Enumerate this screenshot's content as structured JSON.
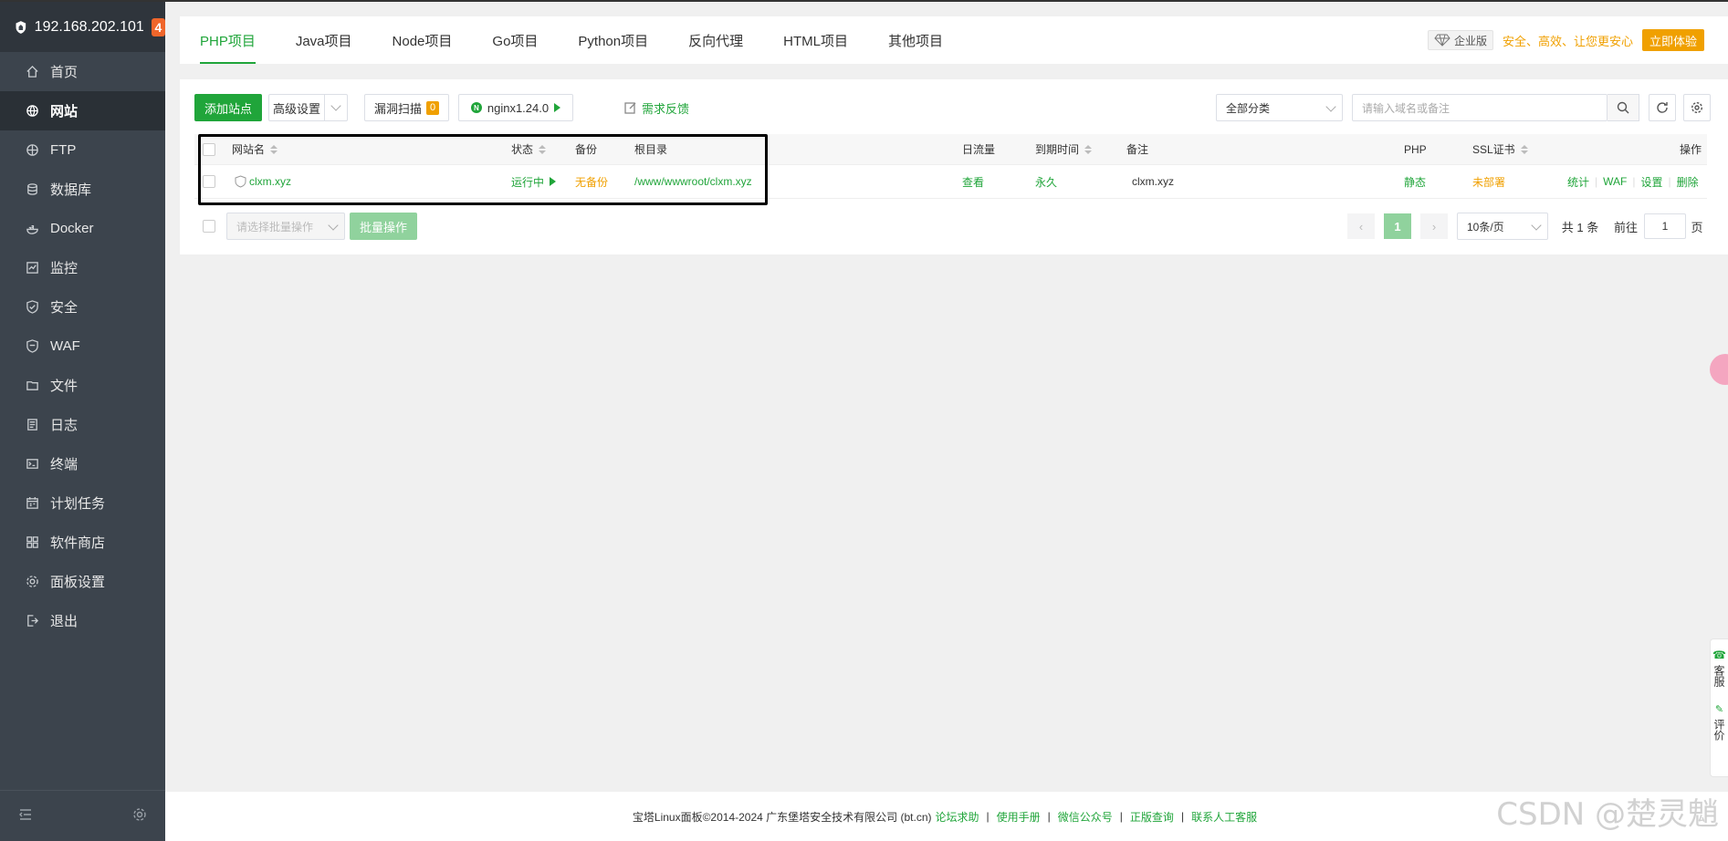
{
  "sidebar": {
    "ip": "192.168.202.101",
    "badge": "4",
    "items": [
      {
        "label": "首页",
        "icon": "home-icon"
      },
      {
        "label": "网站",
        "icon": "globe-icon",
        "active": true
      },
      {
        "label": "FTP",
        "icon": "ftp-globe-icon"
      },
      {
        "label": "数据库",
        "icon": "database-icon"
      },
      {
        "label": "Docker",
        "icon": "docker-icon"
      },
      {
        "label": "监控",
        "icon": "monitor-icon"
      },
      {
        "label": "安全",
        "icon": "shield-icon"
      },
      {
        "label": "WAF",
        "icon": "waf-shield-icon"
      },
      {
        "label": "文件",
        "icon": "folder-icon"
      },
      {
        "label": "日志",
        "icon": "log-icon"
      },
      {
        "label": "终端",
        "icon": "terminal-icon"
      },
      {
        "label": "计划任务",
        "icon": "calendar-icon"
      },
      {
        "label": "软件商店",
        "icon": "apps-icon"
      },
      {
        "label": "面板设置",
        "icon": "gear-icon"
      },
      {
        "label": "退出",
        "icon": "logout-icon"
      }
    ]
  },
  "tabs": [
    "PHP项目",
    "Java项目",
    "Node项目",
    "Go项目",
    "Python项目",
    "反向代理",
    "HTML项目",
    "其他项目"
  ],
  "promo": {
    "edition": "企业版",
    "slogan": "安全、高效、让您更安心",
    "try_label": "立即体验"
  },
  "toolbar": {
    "add_site": "添加站点",
    "advanced": "高级设置",
    "vuln_scan": "漏洞扫描",
    "vuln_count": "0",
    "nginx": "nginx1.24.0",
    "nginx_badge": "N",
    "feedback": "需求反馈",
    "category": "全部分类",
    "search_placeholder": "请输入域名或备注"
  },
  "table": {
    "headers": {
      "name": "网站名",
      "status": "状态",
      "backup": "备份",
      "root": "根目录",
      "traffic": "日流量",
      "expire": "到期时间",
      "remark": "备注",
      "php": "PHP",
      "ssl": "SSL证书",
      "ops": "操作"
    },
    "rows": [
      {
        "name": "clxm.xyz",
        "status": "运行中",
        "backup": "无备份",
        "root": "/www/wwwroot/clxm.xyz",
        "traffic": "查看",
        "expire": "永久",
        "remark": "clxm.xyz",
        "php": "静态",
        "ssl": "未部署",
        "ops": [
          "统计",
          "WAF",
          "设置",
          "删除"
        ]
      }
    ]
  },
  "bulk": {
    "select_placeholder": "请选择批量操作",
    "button": "批量操作"
  },
  "pagination": {
    "current": "1",
    "per_page": "10条/页",
    "total": "共 1 条",
    "goto_label": "前往",
    "goto_value": "1",
    "page_suffix": "页"
  },
  "footer": {
    "copyright": "宝塔Linux面板©2014-2024 广东堡塔安全技术有限公司 (bt.cn)",
    "links": [
      "论坛求助",
      "使用手册",
      "微信公众号",
      "正版查询",
      "联系人工客服"
    ]
  },
  "side_float": {
    "service": "客服",
    "feedback": "评价"
  },
  "watermark": "CSDN @楚灵魈",
  "colors": {
    "accent": "#20a53a",
    "warning": "#f0a000",
    "sidebar": "#3c444d"
  }
}
